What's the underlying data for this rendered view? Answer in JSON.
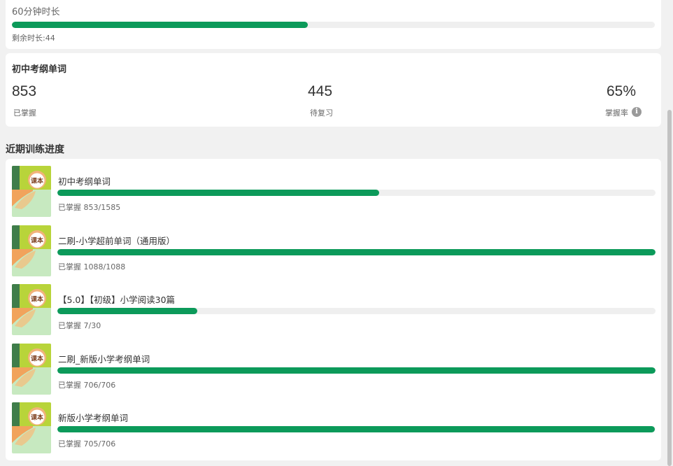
{
  "duration": {
    "title": "60分钟时长",
    "progress_percent": 46,
    "remaining_text": "剩余时长:44"
  },
  "stats": {
    "title": "初中考纲单词",
    "mastered_value": "853",
    "mastered_label": "已掌握",
    "review_value": "445",
    "review_label": "待复习",
    "rate_value": "65%",
    "rate_label": "掌握率",
    "info_icon": "info-icon"
  },
  "recent": {
    "title": "近期训练进度",
    "thumb_badge": "课本",
    "items": [
      {
        "title": "初中考纲单词",
        "progress_text": "已掌握 853/1585",
        "mastered": 853,
        "total": 1585
      },
      {
        "title": "二刷-小学超前单词（通用版）",
        "progress_text": "已掌握 1088/1088",
        "mastered": 1088,
        "total": 1088
      },
      {
        "title": "【5.0】【初级】小学阅读30篇",
        "progress_text": "已掌握 7/30",
        "mastered": 7,
        "total": 30
      },
      {
        "title": "二刷_新版小学考纲单词",
        "progress_text": "已掌握 706/706",
        "mastered": 706,
        "total": 706
      },
      {
        "title": "新版小学考纲单词",
        "progress_text": "已掌握 705/706",
        "mastered": 705,
        "total": 706
      }
    ]
  },
  "colors": {
    "accent": "#0c9a5a",
    "track": "#efefef",
    "background": "#f1f1f1"
  }
}
